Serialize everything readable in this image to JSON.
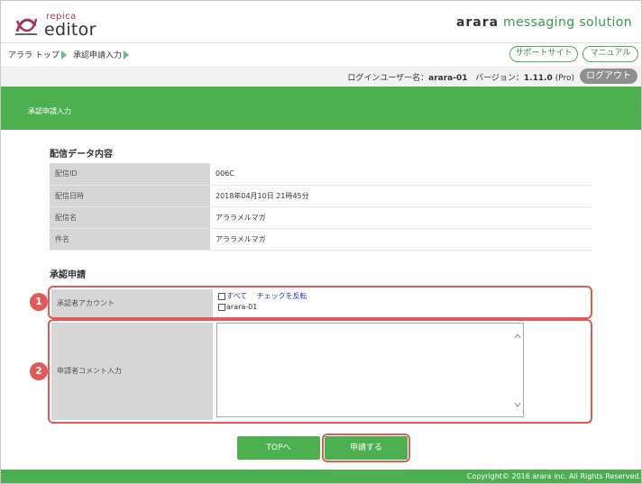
{
  "header": {
    "logo_small": "repica",
    "logo_big": "editor",
    "brand_bold": "arara",
    "brand_rest": "messaging solution"
  },
  "breadcrumb": {
    "items": [
      "アララ トップ",
      "承認申請入力"
    ]
  },
  "top_buttons": {
    "support": "サポートサイト",
    "manual": "マニュアル"
  },
  "login": {
    "user_label": "ログインユーザー名：",
    "user_value": "arara-01",
    "version_label": "バージョン：",
    "version_value": "1.11.0",
    "version_suffix": "(Pro)",
    "logout": "ログアウト"
  },
  "page_title": "承認申請入力",
  "delivery": {
    "section_title": "配信データ内容",
    "rows": [
      {
        "label": "配信ID",
        "value": "006C"
      },
      {
        "label": "配信日時",
        "value": "2018年04月10日 21時45分"
      },
      {
        "label": "配信名",
        "value": "アララメルマガ"
      },
      {
        "label": "件名",
        "value": "アララメルマガ"
      }
    ]
  },
  "approval": {
    "section_title": "承認申請",
    "account_label": "承認者アカウント",
    "all_label": "すべて",
    "invert_label": "チェックを反転",
    "accounts": [
      "arara-01"
    ],
    "comment_label": "申請者コメント入力",
    "comment_value": ""
  },
  "badges": [
    "1",
    "2"
  ],
  "actions": {
    "top": "TOPへ",
    "submit": "申請する"
  },
  "footer": {
    "copyright": "Copyright© 2016 arara inc. All Rights Reserved."
  },
  "colors": {
    "brand_green": "#4caf50",
    "highlight_red": "#e05a5a",
    "logo_purple": "#9b3a55"
  }
}
